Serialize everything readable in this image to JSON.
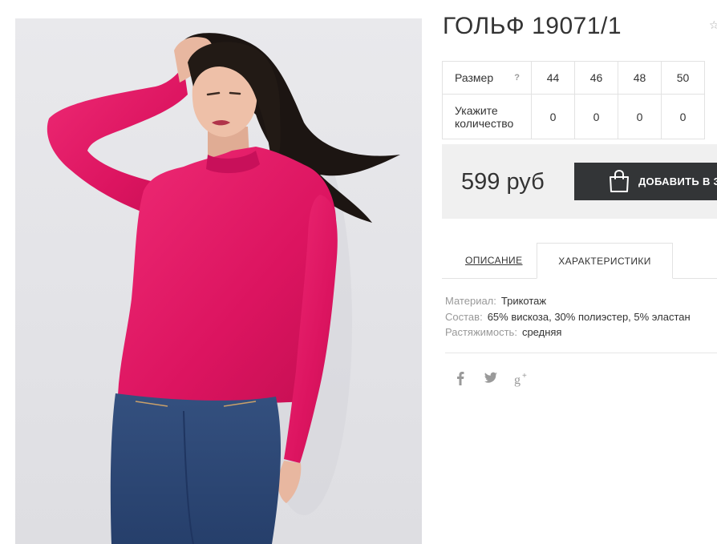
{
  "product": {
    "title": "ГОЛЬФ 19071/1",
    "image_alt": "Женщина в розовом гольфе и джинсах"
  },
  "size_table": {
    "size_label": "Размер",
    "help": "?",
    "sizes": [
      "44",
      "46",
      "48",
      "50"
    ],
    "qty_label_line1": "Укажите",
    "qty_label_line2": "количество",
    "quantities": [
      "0",
      "0",
      "0",
      "0"
    ]
  },
  "purchase": {
    "price": "599 руб",
    "cart_button": "ДОБАВИТЬ В ЗАКАЗ"
  },
  "tabs": {
    "description": "ОПИСАНИЕ",
    "characteristics": "ХАРАКТЕРИСТИКИ",
    "active": "characteristics"
  },
  "characteristics": [
    {
      "key": "Материал:",
      "value": "Трикотаж"
    },
    {
      "key": "Состав:",
      "value": "65% вискоза, 30% полиэстер, 5% эластан"
    },
    {
      "key": "Растяжимость:",
      "value": "средняя"
    }
  ],
  "social": [
    "facebook-icon",
    "twitter-icon",
    "google-plus-icon"
  ],
  "colors": {
    "button_bg": "#333537",
    "price_box_bg": "#f0f0f0",
    "sweater": "#e0155f",
    "jeans": "#2e4a7a"
  }
}
